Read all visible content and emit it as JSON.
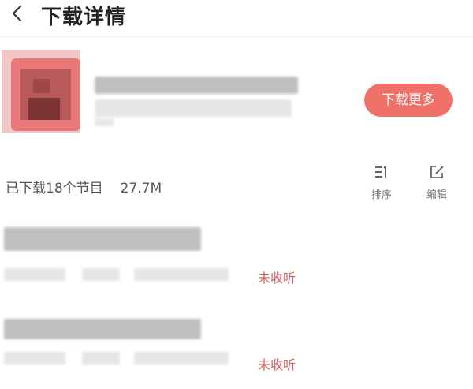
{
  "header": {
    "title": "下载详情"
  },
  "album": {
    "download_more_label": "下载更多"
  },
  "summary": {
    "count_text": "已下载18个节目",
    "size_text": "27.7M"
  },
  "toolbar": {
    "sort_label": "排序",
    "edit_label": "编辑"
  },
  "episodes": [
    {
      "status": "未收听"
    },
    {
      "status": "未收听"
    }
  ],
  "colors": {
    "accent": "#f0716a",
    "status_red": "#d4605c"
  }
}
